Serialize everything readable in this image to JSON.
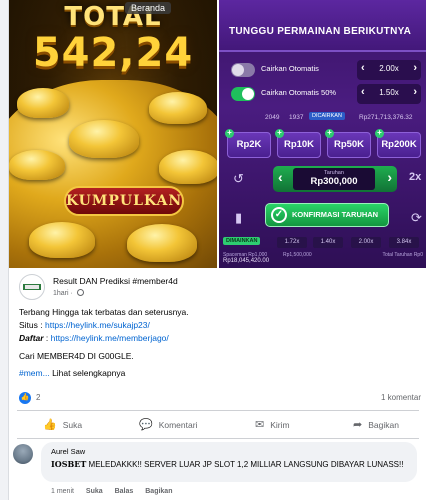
{
  "promo": {
    "left_panel": {
      "title": "TOTAL",
      "amount": "542,24",
      "collect_label": "KUMPULKAN",
      "tooltip": "Beranda"
    },
    "right_panel": {
      "header": "TUNGGU PERMAINAN BERIKUTNYA",
      "auto_rows": [
        {
          "label": "Cairkan Otomatis",
          "value": "2.00x",
          "on": false
        },
        {
          "label": "Cairkan Otomatis 50%",
          "value": "1.50x",
          "on": true
        }
      ],
      "stats": {
        "count1": "2049",
        "count2": "1937",
        "badge": "DICAIRKAN",
        "amount": "Rp271,713,376.32"
      },
      "chips": [
        "Rp2K",
        "Rp10K",
        "Rp50K",
        "Rp200K"
      ],
      "bet": {
        "label": "Taruhan",
        "amount": "Rp300,000",
        "multiplier": "2x"
      },
      "confirm_label": "KONFIRMASI TARUHAN",
      "played": {
        "tag": "DIMAINKAN",
        "multipliers": [
          "1.72x",
          "1.40x",
          "2.00x",
          "3.84x"
        ]
      },
      "footer_left": "Spaceman   Rp1,000",
      "footer_mid": "Rp1,500,000",
      "footer_amount": "Rp18,045,420.00",
      "footer_right": "Total Taruhan  Rp0"
    }
  },
  "post": {
    "author": "Result DAN Prediksi #member4d",
    "time": "1hari",
    "lines": {
      "tagline": "Terbang Hingga tak terbatas dan seterusnya.",
      "situs_label": "Situs : ",
      "situs_link": "https://heylink.me/sukajp23/",
      "daftar_label": "Daftar",
      "daftar_sep": " : ",
      "daftar_link": "https://heylink.me/memberjago/",
      "search": "Cari MEMBER4D DI G00GLE.",
      "hashtag": "#mem...",
      "see_more": " Lihat selengkapnya"
    },
    "reactions": {
      "likes": "2",
      "comments": "1 komentar"
    },
    "actions": {
      "like": "Suka",
      "comment": "Komentari",
      "share": "Kirim",
      "bagikan": "Bagikan"
    }
  },
  "comment": {
    "name": "Aurel Saw",
    "brand": "IOSBET",
    "text": " MELEDAKKK!! SERVER LUAR JP SLOT 1,2 MILLIAR LANGSUNG DIBAYAR LUNASS!!",
    "time": "1 menit",
    "like": "Suka",
    "reply": "Balas",
    "share": "Bagikan"
  },
  "colors": {
    "link": "#0064d1",
    "facebook_blue": "#1877f2",
    "game_purple": "#4a1c80",
    "accent_green": "#2ecc71"
  }
}
